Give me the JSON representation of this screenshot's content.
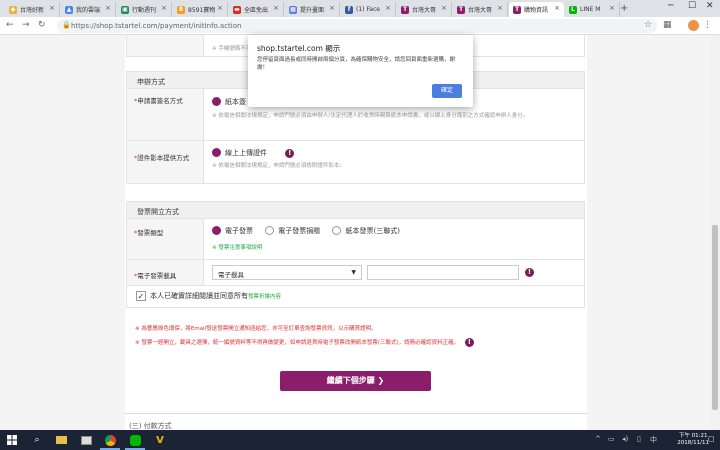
{
  "browser": {
    "tabs": [
      {
        "title": "台灣好新",
        "fav_color": "#e8b33a",
        "fav": "◆"
      },
      {
        "title": "我的雲端",
        "fav_color": "#4285f4",
        "fav": "▲"
      },
      {
        "title": "行動週刊",
        "fav_color": "#1c8a5a",
        "fav": "▣"
      },
      {
        "title": "8591寶物",
        "fav_color": "#f59a23",
        "fav": "8"
      },
      {
        "title": "全區免出",
        "fav_color": "#d22b2b",
        "fav": "▬"
      },
      {
        "title": "提升畫面",
        "fav_color": "#5b7fd6",
        "fav": "▦"
      },
      {
        "title": "(1) Face",
        "fav_color": "#3b5998",
        "fav": "f"
      },
      {
        "title": "台灣大哥",
        "fav_color": "#8a1e6b",
        "fav": "T"
      },
      {
        "title": "台灣大哥",
        "fav_color": "#8a1e6b",
        "fav": "T"
      },
      {
        "title": "購物資訊",
        "fav_color": "#8a1e6b",
        "fav": "T"
      },
      {
        "title": "LINE M",
        "fav_color": "#00b900",
        "fav": "L"
      }
    ],
    "url": "https://shop.tstartel.com/payment/initInfo.action"
  },
  "form": {
    "phone_note": "※ 手機號碼不可與",
    "apply_section": "申辦方式",
    "sign_label": "申請書簽名方式",
    "sign_option": "紙本簽",
    "sign_note": "※ 依電信相關法規規定，申請門號必須由申辦人/法定代理人於收貨時親簽紙本申請書，或以線上身分識別之方式確認申辦人身分。",
    "cert_label": "證件影本提供方式",
    "cert_option": "線上上傳證件",
    "cert_note": "※ 依電信相關法規規定，申請門號必須檢附證件影本。",
    "invoice_section": "發票開立方式",
    "invoice_type_label": "發票類型",
    "invoice_options": [
      "電子發票",
      "電子發票捐贈",
      "紙本發票(三聯式)"
    ],
    "invoice_note": "※ 發票注意事項說明",
    "carrier_label": "電子發票載具",
    "carrier_value": "電子載具",
    "agree_text": "本人已確實詳細閱讀並同意所有",
    "agree_link": "發票折讓內容",
    "red_note_1": "※ 為響應綠色環保，將Email發送發票開立通知函給您，亦可至訂單查詢發票資訊，以示購買證明。",
    "red_note_2": "※ 發票一經開立，載具之選擇，統一編號資料等不得再做變更，如申請退貨時電子發票改開紙本發票(三聯式)，請務必確認資料正確。",
    "next_button": "繼續下個步驟 ❯",
    "next_section": "(三) 付款方式"
  },
  "dialog": {
    "title": "shop.tstartel.com 顯示",
    "message": "您停留頁面過長或同時開啟兩個分頁，為確保購物安全，請您回頁面重新選購，謝謝！",
    "ok": "確定"
  },
  "taskbar": {
    "time": "下午 01:21",
    "date": "2018/11/11"
  }
}
